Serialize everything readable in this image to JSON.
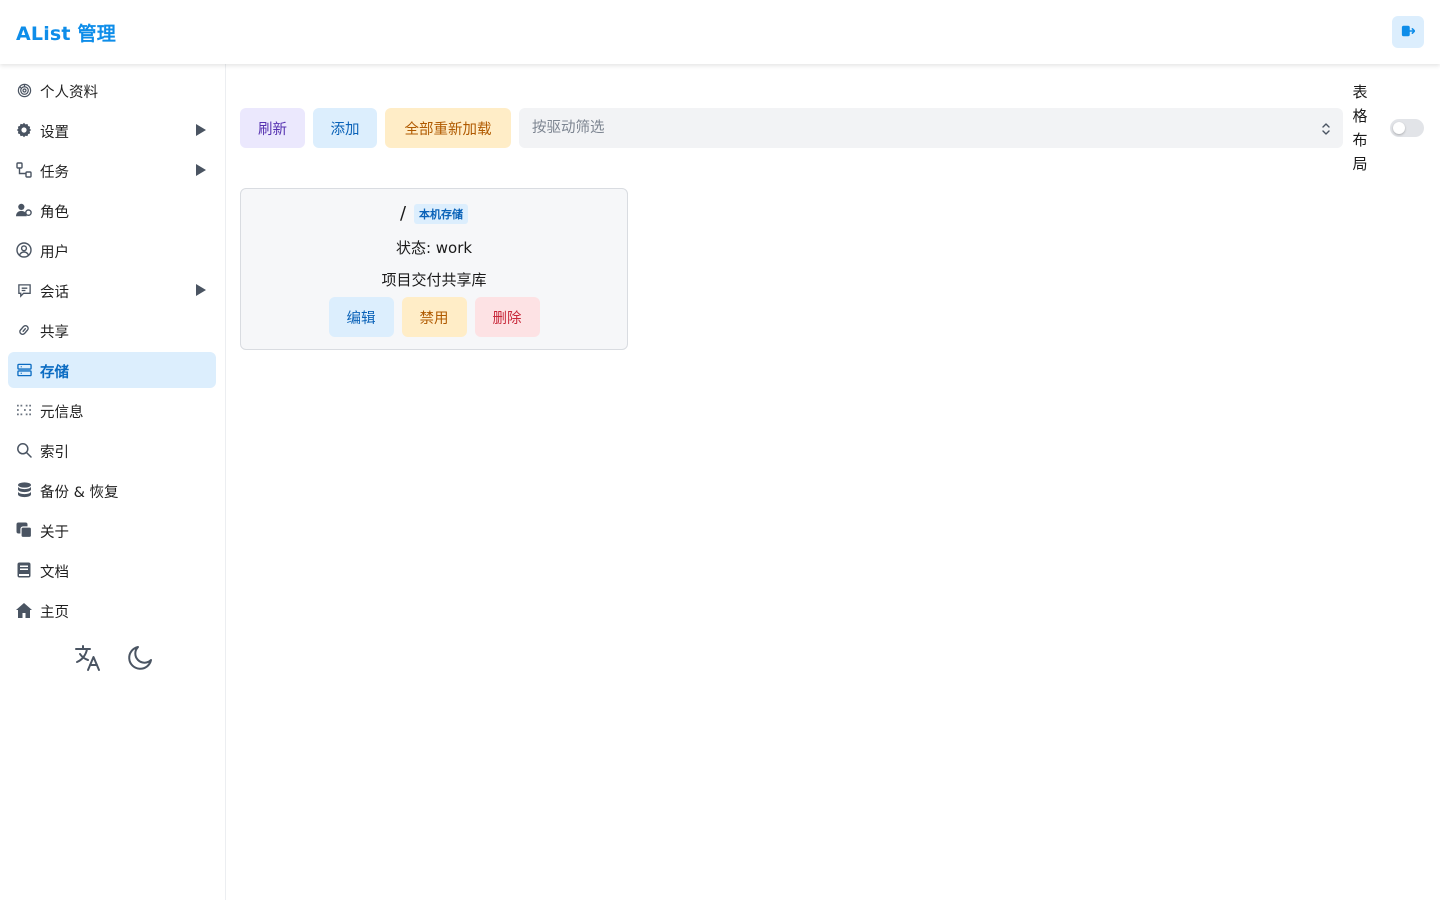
{
  "header": {
    "brand": "AList 管理",
    "logout_icon": "logout-icon"
  },
  "sidebar": {
    "items": [
      {
        "label": "个人资料",
        "icon": "fingerprint-icon",
        "expandable": false
      },
      {
        "label": "设置",
        "icon": "gear-icon",
        "expandable": true
      },
      {
        "label": "任务",
        "icon": "flow-icon",
        "expandable": true
      },
      {
        "label": "角色",
        "icon": "user-gear-icon",
        "expandable": false
      },
      {
        "label": "用户",
        "icon": "user-circle-icon",
        "expandable": false
      },
      {
        "label": "会话",
        "icon": "message-icon",
        "expandable": true
      },
      {
        "label": "共享",
        "icon": "link-icon",
        "expandable": false
      },
      {
        "label": "存储",
        "icon": "database-icon",
        "expandable": false,
        "active": true
      },
      {
        "label": "元信息",
        "icon": "metadata-icon",
        "expandable": false
      },
      {
        "label": "索引",
        "icon": "search-icon",
        "expandable": false
      },
      {
        "label": "备份 & 恢复",
        "icon": "backup-icon",
        "expandable": false
      },
      {
        "label": "关于",
        "icon": "copy-icon",
        "expandable": false
      },
      {
        "label": "文档",
        "icon": "book-icon",
        "expandable": false
      },
      {
        "label": "主页",
        "icon": "home-icon",
        "expandable": false
      }
    ],
    "tools": [
      "translate-icon",
      "moon-icon"
    ]
  },
  "toolbar": {
    "refresh_label": "刷新",
    "add_label": "添加",
    "reload_all_label": "全部重新加载",
    "filter_placeholder": "按驱动筛选",
    "layout_label": "表格布局",
    "table_layout_on": false
  },
  "storages": [
    {
      "mount_path": "/",
      "driver": "本机存储",
      "status": "状态: work",
      "remark": "项目交付共享库",
      "edit_label": "编辑",
      "disable_label": "禁用",
      "delete_label": "删除"
    }
  ],
  "colors": {
    "accent": "#0e8de9",
    "active_bg": "#dceefd",
    "warning_bg": "#ffedc7",
    "danger_bg": "#fde2e4",
    "purple_bg": "#ebe8fd"
  }
}
